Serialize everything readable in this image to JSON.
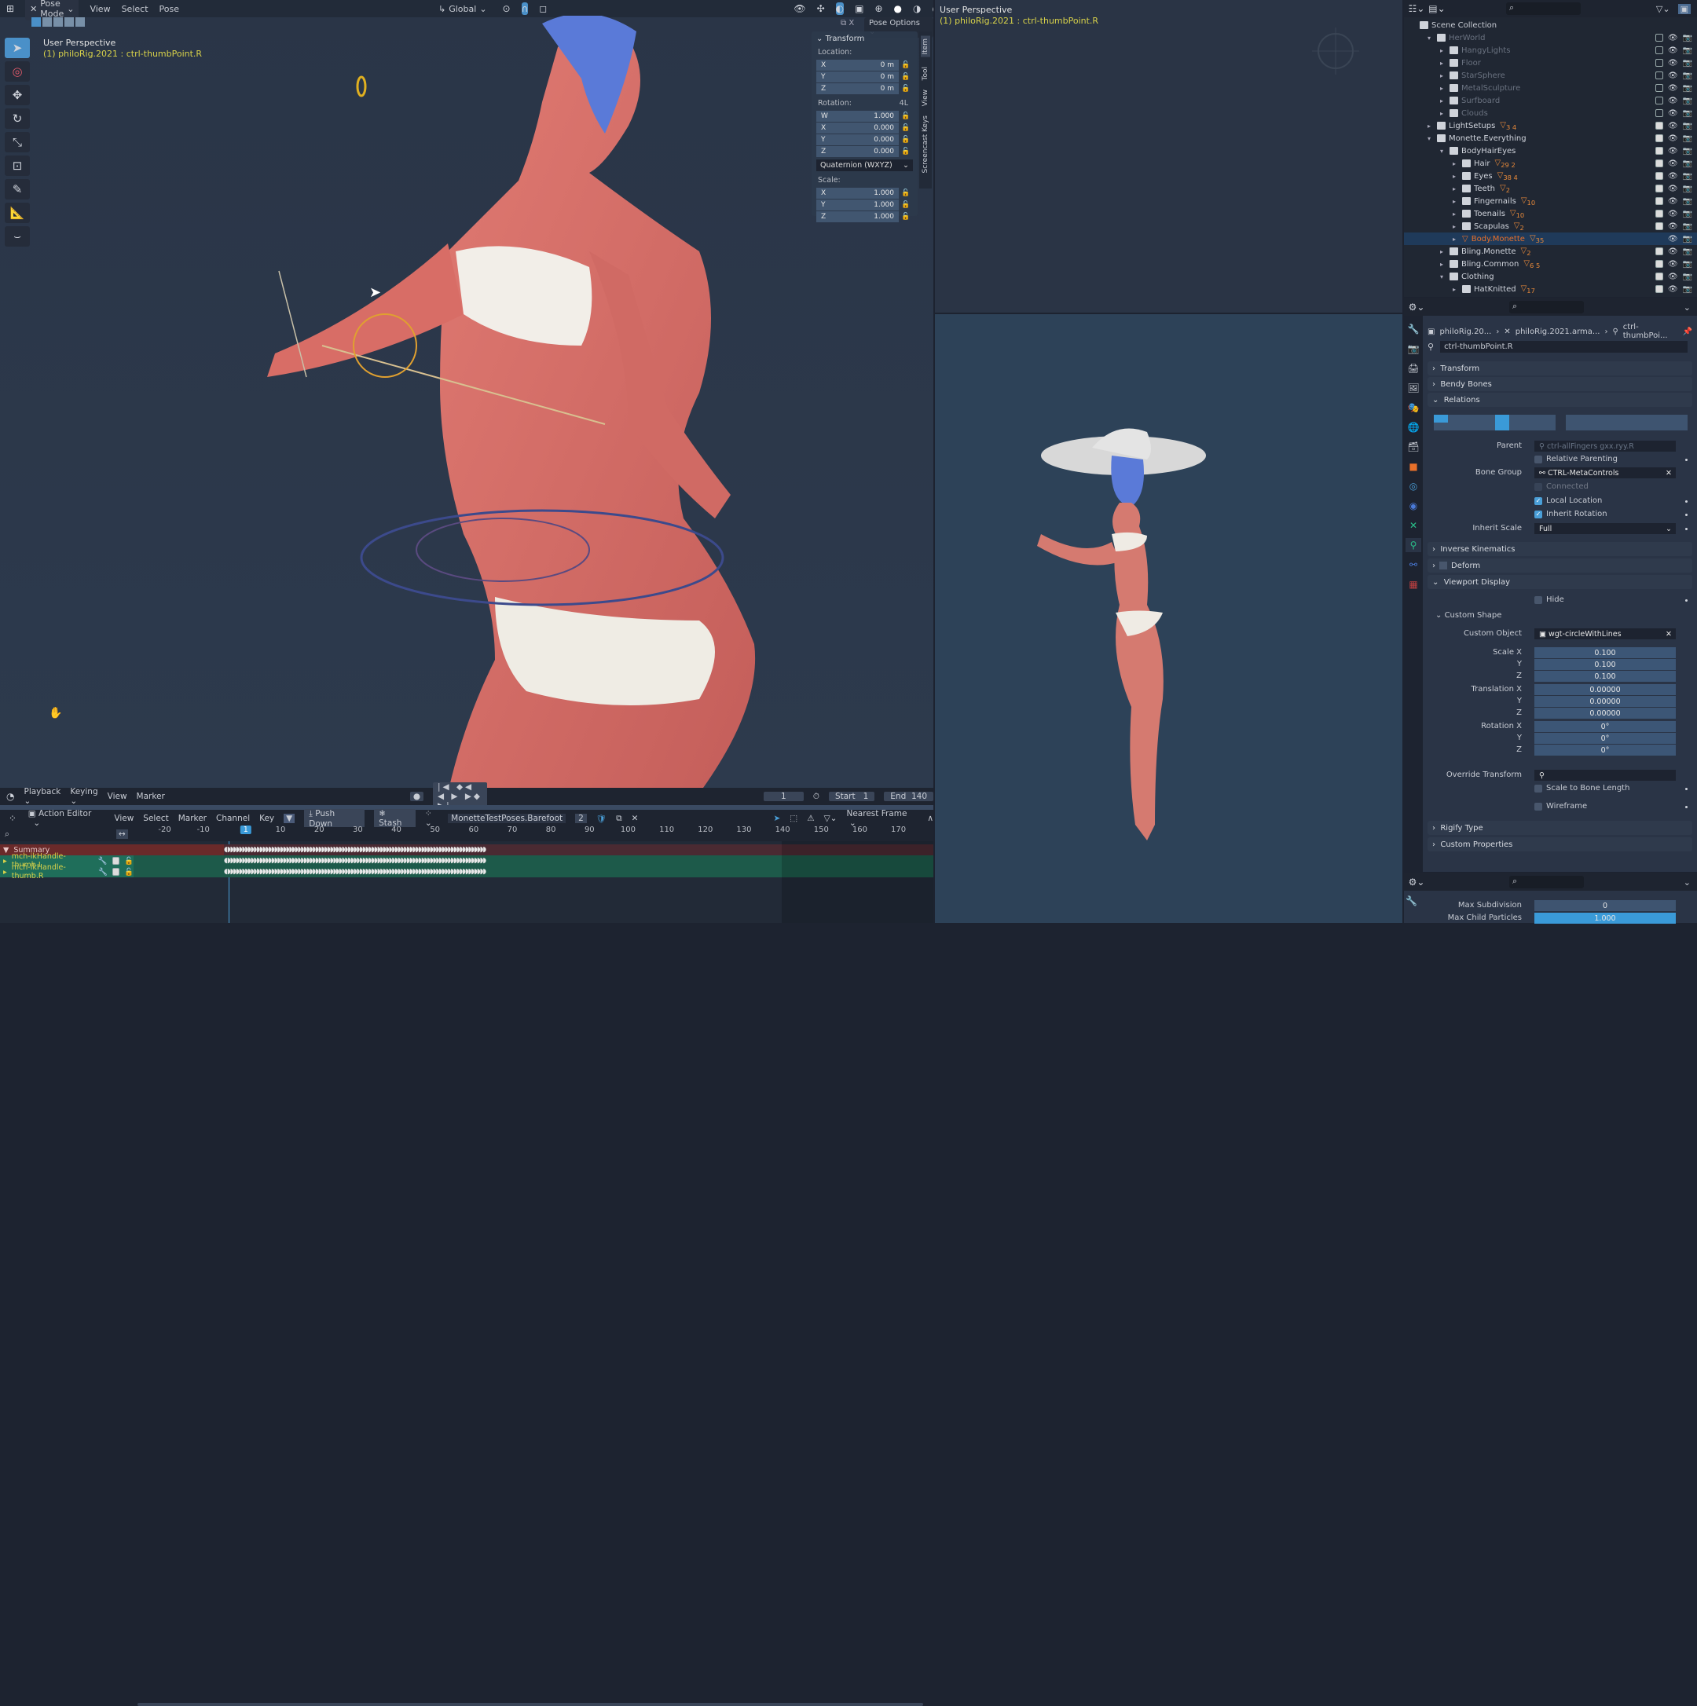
{
  "main_viewport": {
    "header": {
      "mode": "Pose Mode",
      "menus": [
        "View",
        "Select",
        "Pose"
      ],
      "orientation": "Global"
    },
    "title": "User Perspective",
    "subtitle": "(1) philoRig.2021 : ctrl-thumbPoint.R",
    "pose_options": "Pose Options",
    "tools": [
      "select-box",
      "cursor",
      "move",
      "rotate",
      "scale",
      "transform",
      "annotate",
      "measure",
      "bone-envelope"
    ],
    "sidebar_tabs": [
      "Item",
      "Tool",
      "View",
      "Screencast Keys"
    ],
    "transform_panel": {
      "title": "Transform",
      "location_label": "Location:",
      "location": [
        {
          "axis": "X",
          "value": "0 m"
        },
        {
          "axis": "Y",
          "value": "0 m"
        },
        {
          "axis": "Z",
          "value": "0 m"
        }
      ],
      "rotation_label": "Rotation:",
      "rotation_mode_short": "4L",
      "rotation": [
        {
          "axis": "W",
          "value": "1.000"
        },
        {
          "axis": "X",
          "value": "0.000"
        },
        {
          "axis": "Y",
          "value": "0.000"
        },
        {
          "axis": "Z",
          "value": "0.000"
        }
      ],
      "rotation_mode": "Quaternion (WXYZ)",
      "scale_label": "Scale:",
      "scale": [
        {
          "axis": "X",
          "value": "1.000"
        },
        {
          "axis": "Y",
          "value": "1.000"
        },
        {
          "axis": "Z",
          "value": "1.000"
        }
      ]
    }
  },
  "timeline": {
    "menus": [
      "Playback",
      "Keying",
      "View",
      "Marker"
    ],
    "current_frame": "1",
    "start_label": "Start",
    "start": "1",
    "end_label": "End",
    "end": "140"
  },
  "action_editor": {
    "mode": "Action Editor",
    "menus": [
      "View",
      "Select",
      "Marker",
      "Channel",
      "Key"
    ],
    "push_down": "Push Down",
    "stash": "Stash",
    "action_name": "MonetteTestPoses.Barefoot",
    "users": "2",
    "snap": "Nearest Frame",
    "frame_ticks": [
      "-20",
      "-10",
      "1",
      "10",
      "20",
      "30",
      "40",
      "50",
      "60",
      "70",
      "80",
      "90",
      "100",
      "110",
      "120",
      "130",
      "140",
      "150",
      "160",
      "170"
    ],
    "channels": [
      {
        "name": "Summary",
        "type": "summary"
      },
      {
        "name": "mch-ikHandle-thumb.L",
        "type": "group"
      },
      {
        "name": "mch-ikHandle-thumb.R",
        "type": "group"
      }
    ]
  },
  "top_right_viewport": {
    "title": "User Perspective",
    "subtitle": "(1) philoRig.2021 : ctrl-thumbPoint.R"
  },
  "outliner": {
    "root": "Scene Collection",
    "items": [
      {
        "name": "HerWorld",
        "depth": 1,
        "expanded": true,
        "excluded": true
      },
      {
        "name": "HangyLights",
        "depth": 2,
        "excluded": true
      },
      {
        "name": "Floor",
        "depth": 2,
        "excluded": true
      },
      {
        "name": "StarSphere",
        "depth": 2,
        "excluded": true
      },
      {
        "name": "MetalSculpture",
        "depth": 2,
        "excluded": true
      },
      {
        "name": "Surfboard",
        "depth": 2,
        "excluded": true
      },
      {
        "name": "Clouds",
        "depth": 2,
        "excluded": true
      },
      {
        "name": "LightSetups",
        "depth": 1,
        "badges": "3 4"
      },
      {
        "name": "Monette.Everything",
        "depth": 1,
        "expanded": true
      },
      {
        "name": "BodyHairEyes",
        "depth": 2,
        "expanded": true
      },
      {
        "name": "Hair",
        "depth": 3,
        "badges": "29 2"
      },
      {
        "name": "Eyes",
        "depth": 3,
        "badges": "38 4"
      },
      {
        "name": "Teeth",
        "depth": 3,
        "badges": "2"
      },
      {
        "name": "Fingernails",
        "depth": 3,
        "badges": "10"
      },
      {
        "name": "Toenails",
        "depth": 3,
        "badges": "10"
      },
      {
        "name": "Scapulas",
        "depth": 3,
        "badges": "2"
      },
      {
        "name": "Body.Monette",
        "depth": 3,
        "active": true,
        "badges": "35"
      },
      {
        "name": "Bling.Monette",
        "depth": 2,
        "badges": "2"
      },
      {
        "name": "Bling.Common",
        "depth": 2,
        "badges": "6 5"
      },
      {
        "name": "Clothing",
        "depth": 2,
        "expanded": true
      },
      {
        "name": "HatKnitted",
        "depth": 3,
        "badges": "17"
      }
    ]
  },
  "properties": {
    "breadcrumb": [
      "philoRig.20...",
      "philoRig.2021.arma...",
      "ctrl-thumbPoi..."
    ],
    "bone_name": "ctrl-thumbPoint.R",
    "sections": {
      "transform": "Transform",
      "bendy_bones": "Bendy Bones",
      "relations": "Relations",
      "inverse_kinematics": "Inverse Kinematics",
      "deform": "Deform",
      "viewport_display": "Viewport Display",
      "custom_shape": "Custom Shape",
      "rigify_type": "Rigify Type",
      "custom_properties": "Custom Properties"
    },
    "relations": {
      "parent_label": "Parent",
      "parent": "ctrl-allFingers gxx.ryy.R",
      "relative_parenting": {
        "label": "Relative Parenting",
        "checked": false
      },
      "bone_group_label": "Bone Group",
      "bone_group": "CTRL-MetaControls",
      "connected": {
        "label": "Connected",
        "checked": false
      },
      "local_location": {
        "label": "Local Location",
        "checked": true
      },
      "inherit_rotation": {
        "label": "Inherit Rotation",
        "checked": true
      },
      "inherit_scale_label": "Inherit Scale",
      "inherit_scale": "Full"
    },
    "viewport_display": {
      "hide": {
        "label": "Hide",
        "checked": false
      },
      "custom_object_label": "Custom Object",
      "custom_object": "wgt-circleWithLines",
      "scale_labels": [
        "Scale X",
        "Y",
        "Z"
      ],
      "scale": [
        "0.100",
        "0.100",
        "0.100"
      ],
      "translation_labels": [
        "Translation X",
        "Y",
        "Z"
      ],
      "translation": [
        "0.00000",
        "0.00000",
        "0.00000"
      ],
      "rotation_labels": [
        "Rotation X",
        "Y",
        "Z"
      ],
      "rotation": [
        "0°",
        "0°",
        "0°"
      ],
      "override_transform_label": "Override Transform",
      "scale_to_bone_length": {
        "label": "Scale to Bone Length",
        "checked": false
      },
      "wireframe": {
        "label": "Wireframe",
        "checked": false
      }
    }
  },
  "properties2": {
    "max_subdivision_label": "Max Subdivision",
    "max_subdivision": "0",
    "max_child_particles_label": "Max Child Particles",
    "max_child_particles": "1.000"
  },
  "colors": {
    "accent": "#4a9fd8",
    "active_text": "#d8d24a",
    "selected_object": "#e8702a",
    "channel_green": "#1f6e5a"
  }
}
